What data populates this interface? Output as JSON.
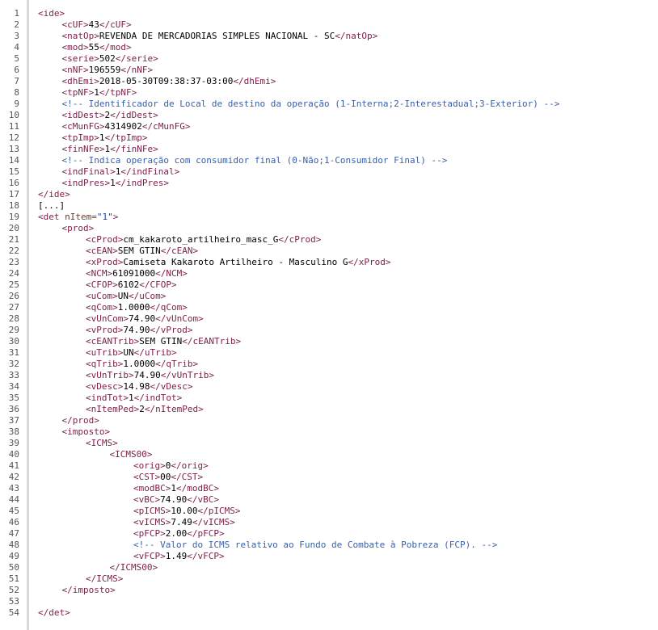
{
  "editor": {
    "line_numbers": [
      "1",
      "2",
      "3",
      "4",
      "5",
      "6",
      "7",
      "8",
      "9",
      "10",
      "11",
      "12",
      "13",
      "14",
      "15",
      "16",
      "17",
      "18",
      "19",
      "20",
      "21",
      "22",
      "23",
      "24",
      "25",
      "26",
      "27",
      "28",
      "29",
      "30",
      "31",
      "32",
      "33",
      "34",
      "35",
      "36",
      "37",
      "38",
      "39",
      "40",
      "41",
      "42",
      "43",
      "44",
      "45",
      "46",
      "47",
      "48",
      "49",
      "50",
      "51",
      "52",
      "53",
      "54"
    ],
    "lines": [
      {
        "indent": 0,
        "parts": [
          {
            "t": "tag",
            "v": "<ide>"
          }
        ]
      },
      {
        "indent": 1,
        "parts": [
          {
            "t": "tag",
            "v": "<cUF>"
          },
          {
            "t": "text",
            "v": "43"
          },
          {
            "t": "tag",
            "v": "</cUF>"
          }
        ]
      },
      {
        "indent": 1,
        "parts": [
          {
            "t": "tag",
            "v": "<natOp>"
          },
          {
            "t": "text",
            "v": "REVENDA DE MERCADORIAS SIMPLES NACIONAL - SC"
          },
          {
            "t": "tag",
            "v": "</natOp>"
          }
        ]
      },
      {
        "indent": 1,
        "parts": [
          {
            "t": "tag",
            "v": "<mod>"
          },
          {
            "t": "text",
            "v": "55"
          },
          {
            "t": "tag",
            "v": "</mod>"
          }
        ]
      },
      {
        "indent": 1,
        "parts": [
          {
            "t": "tag",
            "v": "<serie>"
          },
          {
            "t": "text",
            "v": "502"
          },
          {
            "t": "tag",
            "v": "</serie>"
          }
        ]
      },
      {
        "indent": 1,
        "parts": [
          {
            "t": "tag",
            "v": "<nNF>"
          },
          {
            "t": "text",
            "v": "196559"
          },
          {
            "t": "tag",
            "v": "</nNF>"
          }
        ]
      },
      {
        "indent": 1,
        "parts": [
          {
            "t": "tag",
            "v": "<dhEmi>"
          },
          {
            "t": "text",
            "v": "2018-05-30T09:38:37-03:00"
          },
          {
            "t": "tag",
            "v": "</dhEmi>"
          }
        ]
      },
      {
        "indent": 1,
        "parts": [
          {
            "t": "tag",
            "v": "<tpNF>"
          },
          {
            "t": "text",
            "v": "1"
          },
          {
            "t": "tag",
            "v": "</tpNF>"
          }
        ]
      },
      {
        "indent": 1,
        "parts": [
          {
            "t": "comment",
            "v": "<!-- Identificador de Local de destino da operação (1-Interna;2-Interestadual;3-Exterior) -->"
          }
        ]
      },
      {
        "indent": 1,
        "parts": [
          {
            "t": "tag",
            "v": "<idDest>"
          },
          {
            "t": "text",
            "v": "2"
          },
          {
            "t": "tag",
            "v": "</idDest>"
          }
        ]
      },
      {
        "indent": 1,
        "parts": [
          {
            "t": "tag",
            "v": "<cMunFG>"
          },
          {
            "t": "text",
            "v": "4314902"
          },
          {
            "t": "tag",
            "v": "</cMunFG>"
          }
        ]
      },
      {
        "indent": 1,
        "parts": [
          {
            "t": "tag",
            "v": "<tpImp>"
          },
          {
            "t": "text",
            "v": "1"
          },
          {
            "t": "tag",
            "v": "</tpImp>"
          }
        ]
      },
      {
        "indent": 1,
        "parts": [
          {
            "t": "tag",
            "v": "<finNFe>"
          },
          {
            "t": "text",
            "v": "1"
          },
          {
            "t": "tag",
            "v": "</finNFe>"
          }
        ]
      },
      {
        "indent": 1,
        "parts": [
          {
            "t": "comment",
            "v": "<!-- Indica operação com consumidor final (0-Não;1-Consumidor Final) -->"
          }
        ]
      },
      {
        "indent": 1,
        "parts": [
          {
            "t": "tag",
            "v": "<indFinal>"
          },
          {
            "t": "text",
            "v": "1"
          },
          {
            "t": "tag",
            "v": "</indFinal>"
          }
        ]
      },
      {
        "indent": 1,
        "parts": [
          {
            "t": "tag",
            "v": "<indPres>"
          },
          {
            "t": "text",
            "v": "1"
          },
          {
            "t": "tag",
            "v": "</indPres>"
          }
        ]
      },
      {
        "indent": 0,
        "parts": [
          {
            "t": "tag",
            "v": "</ide>"
          }
        ]
      },
      {
        "indent": 0,
        "parts": [
          {
            "t": "text",
            "v": "[...]"
          }
        ]
      },
      {
        "indent": 0,
        "parts": [
          {
            "t": "tag",
            "v": "<det "
          },
          {
            "t": "attr",
            "v": "nItem="
          },
          {
            "t": "attrval",
            "v": "\"1\""
          },
          {
            "t": "tag",
            "v": ">"
          }
        ]
      },
      {
        "indent": 1,
        "parts": [
          {
            "t": "tag",
            "v": "<prod>"
          }
        ]
      },
      {
        "indent": 2,
        "parts": [
          {
            "t": "tag",
            "v": "<cProd>"
          },
          {
            "t": "text",
            "v": "cm_kakaroto_artilheiro_masc_G"
          },
          {
            "t": "tag",
            "v": "</cProd>"
          }
        ]
      },
      {
        "indent": 2,
        "parts": [
          {
            "t": "tag",
            "v": "<cEAN>"
          },
          {
            "t": "text",
            "v": "SEM GTIN"
          },
          {
            "t": "tag",
            "v": "</cEAN>"
          }
        ]
      },
      {
        "indent": 2,
        "parts": [
          {
            "t": "tag",
            "v": "<xProd>"
          },
          {
            "t": "text",
            "v": "Camiseta Kakaroto Artilheiro - Masculino G"
          },
          {
            "t": "tag",
            "v": "</xProd>"
          }
        ]
      },
      {
        "indent": 2,
        "parts": [
          {
            "t": "tag",
            "v": "<NCM>"
          },
          {
            "t": "text",
            "v": "61091000"
          },
          {
            "t": "tag",
            "v": "</NCM>"
          }
        ]
      },
      {
        "indent": 2,
        "parts": [
          {
            "t": "tag",
            "v": "<CFOP>"
          },
          {
            "t": "text",
            "v": "6102"
          },
          {
            "t": "tag",
            "v": "</CFOP>"
          }
        ]
      },
      {
        "indent": 2,
        "parts": [
          {
            "t": "tag",
            "v": "<uCom>"
          },
          {
            "t": "text",
            "v": "UN"
          },
          {
            "t": "tag",
            "v": "</uCom>"
          }
        ]
      },
      {
        "indent": 2,
        "parts": [
          {
            "t": "tag",
            "v": "<qCom>"
          },
          {
            "t": "text",
            "v": "1.0000"
          },
          {
            "t": "tag",
            "v": "</qCom>"
          }
        ]
      },
      {
        "indent": 2,
        "parts": [
          {
            "t": "tag",
            "v": "<vUnCom>"
          },
          {
            "t": "text",
            "v": "74.90"
          },
          {
            "t": "tag",
            "v": "</vUnCom>"
          }
        ]
      },
      {
        "indent": 2,
        "parts": [
          {
            "t": "tag",
            "v": "<vProd>"
          },
          {
            "t": "text",
            "v": "74.90"
          },
          {
            "t": "tag",
            "v": "</vProd>"
          }
        ]
      },
      {
        "indent": 2,
        "parts": [
          {
            "t": "tag",
            "v": "<cEANTrib>"
          },
          {
            "t": "text",
            "v": "SEM GTIN"
          },
          {
            "t": "tag",
            "v": "</cEANTrib>"
          }
        ]
      },
      {
        "indent": 2,
        "parts": [
          {
            "t": "tag",
            "v": "<uTrib>"
          },
          {
            "t": "text",
            "v": "UN"
          },
          {
            "t": "tag",
            "v": "</uTrib>"
          }
        ]
      },
      {
        "indent": 2,
        "parts": [
          {
            "t": "tag",
            "v": "<qTrib>"
          },
          {
            "t": "text",
            "v": "1.0000"
          },
          {
            "t": "tag",
            "v": "</qTrib>"
          }
        ]
      },
      {
        "indent": 2,
        "parts": [
          {
            "t": "tag",
            "v": "<vUnTrib>"
          },
          {
            "t": "text",
            "v": "74.90"
          },
          {
            "t": "tag",
            "v": "</vUnTrib>"
          }
        ]
      },
      {
        "indent": 2,
        "parts": [
          {
            "t": "tag",
            "v": "<vDesc>"
          },
          {
            "t": "text",
            "v": "14.98"
          },
          {
            "t": "tag",
            "v": "</vDesc>"
          }
        ]
      },
      {
        "indent": 2,
        "parts": [
          {
            "t": "tag",
            "v": "<indTot>"
          },
          {
            "t": "text",
            "v": "1"
          },
          {
            "t": "tag",
            "v": "</indTot>"
          }
        ]
      },
      {
        "indent": 2,
        "parts": [
          {
            "t": "tag",
            "v": "<nItemPed>"
          },
          {
            "t": "text",
            "v": "2"
          },
          {
            "t": "tag",
            "v": "</nItemPed>"
          }
        ]
      },
      {
        "indent": 1,
        "parts": [
          {
            "t": "tag",
            "v": "</prod>"
          }
        ]
      },
      {
        "indent": 1,
        "parts": [
          {
            "t": "tag",
            "v": "<imposto>"
          }
        ]
      },
      {
        "indent": 2,
        "parts": [
          {
            "t": "tag",
            "v": "<ICMS>"
          }
        ]
      },
      {
        "indent": 3,
        "parts": [
          {
            "t": "tag",
            "v": "<ICMS00>"
          }
        ]
      },
      {
        "indent": 4,
        "parts": [
          {
            "t": "tag",
            "v": "<orig>"
          },
          {
            "t": "text",
            "v": "0"
          },
          {
            "t": "tag",
            "v": "</orig>"
          }
        ]
      },
      {
        "indent": 4,
        "parts": [
          {
            "t": "tag",
            "v": "<CST>"
          },
          {
            "t": "text",
            "v": "00"
          },
          {
            "t": "tag",
            "v": "</CST>"
          }
        ]
      },
      {
        "indent": 4,
        "parts": [
          {
            "t": "tag",
            "v": "<modBC>"
          },
          {
            "t": "text",
            "v": "1"
          },
          {
            "t": "tag",
            "v": "</modBC>"
          }
        ]
      },
      {
        "indent": 4,
        "parts": [
          {
            "t": "tag",
            "v": "<vBC>"
          },
          {
            "t": "text",
            "v": "74.90"
          },
          {
            "t": "tag",
            "v": "</vBC>"
          }
        ]
      },
      {
        "indent": 4,
        "parts": [
          {
            "t": "tag",
            "v": "<pICMS>"
          },
          {
            "t": "text",
            "v": "10.00"
          },
          {
            "t": "tag",
            "v": "</pICMS>"
          }
        ]
      },
      {
        "indent": 4,
        "parts": [
          {
            "t": "tag",
            "v": "<vICMS>"
          },
          {
            "t": "text",
            "v": "7.49"
          },
          {
            "t": "tag",
            "v": "</vICMS>"
          }
        ]
      },
      {
        "indent": 4,
        "parts": [
          {
            "t": "tag",
            "v": "<pFCP>"
          },
          {
            "t": "text",
            "v": "2.00"
          },
          {
            "t": "tag",
            "v": "</pFCP>"
          }
        ]
      },
      {
        "indent": 4,
        "parts": [
          {
            "t": "comment",
            "v": "<!-- Valor do ICMS relativo ao Fundo de Combate à Pobreza (FCP). -->"
          }
        ]
      },
      {
        "indent": 4,
        "parts": [
          {
            "t": "tag",
            "v": "<vFCP>"
          },
          {
            "t": "text",
            "v": "1.49"
          },
          {
            "t": "tag",
            "v": "</vFCP>"
          }
        ]
      },
      {
        "indent": 3,
        "parts": [
          {
            "t": "tag",
            "v": "</ICMS00>"
          }
        ]
      },
      {
        "indent": 2,
        "parts": [
          {
            "t": "tag",
            "v": "</ICMS>"
          }
        ]
      },
      {
        "indent": 1,
        "parts": [
          {
            "t": "tag",
            "v": "</imposto>"
          }
        ]
      },
      {
        "indent": 0,
        "parts": []
      },
      {
        "indent": 0,
        "parts": [
          {
            "t": "tag",
            "v": "</det>"
          }
        ]
      }
    ]
  }
}
